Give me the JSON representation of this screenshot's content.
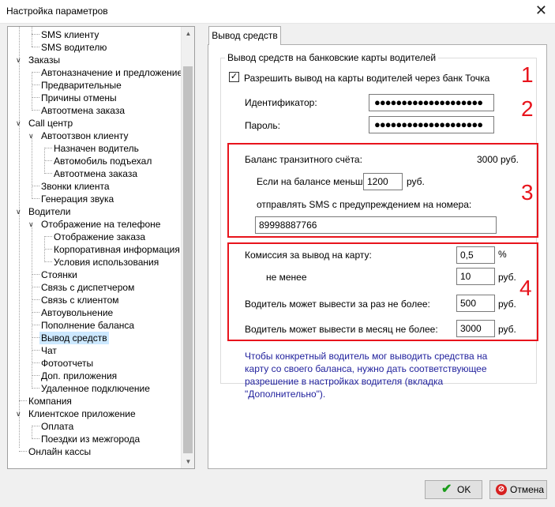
{
  "window": {
    "title": "Настройка параметров"
  },
  "tree": [
    "SMS клиенту",
    "SMS водителю",
    "Заказы",
    "Автоназначение и предложение",
    "Предварительные",
    "Причины отмены",
    "Автоотмена заказа",
    "Call центр",
    "Автоотзвон клиенту",
    "Назначен водитель",
    "Автомобиль подъехал",
    "Автоотмена заказа",
    "Звонки клиента",
    "Генерация звука",
    "Водители",
    "Отображение на телефоне",
    "Отображение заказа",
    "Корпоративная информация",
    "Условия использования",
    "Стоянки",
    "Связь с диспетчером",
    "Связь с клиентом",
    "Автоувольнение",
    "Пополнение баланса",
    "Вывод средств",
    "Чат",
    "Фотоотчеты",
    "Доп. приложения",
    "Удаленное подключение",
    "Компания",
    "Клиентское приложение",
    "Оплата",
    "Поездки из межгорода",
    "Онлайн кассы"
  ],
  "tab": {
    "label": "Вывод средств"
  },
  "group": {
    "title": "Вывод средств на банковские карты водителей"
  },
  "allow": {
    "label": "Разрешить вывод на карты водителей через банк Точка",
    "checked": true
  },
  "identifier": {
    "label": "Идентификатор:",
    "value": "●●●●●●●●●●●●●●●●●●●●"
  },
  "password": {
    "label": "Пароль:",
    "value": "●●●●●●●●●●●●●●●●●●●●"
  },
  "balance": {
    "label": "Баланс транзитного счёта:",
    "value": "3000 руб.",
    "if_less_label": "Если на балансе меньше",
    "threshold": "1200",
    "threshold_unit": "руб.",
    "sms_label": "отправлять SMS с предупреждением на номера:",
    "phones": "89998887766"
  },
  "commission": {
    "label": "Комиссия за вывод на карту:",
    "value": "0,5",
    "unit": "%",
    "min_label": "не менее",
    "min_value": "10",
    "min_unit": "руб."
  },
  "per_withdraw": {
    "label": "Водитель может вывести за раз не более:",
    "value": "500",
    "unit": "руб."
  },
  "per_month": {
    "label": "Водитель может вывести в месяц не более:",
    "value": "3000",
    "unit": "руб."
  },
  "note": "Чтобы конкретный водитель мог выводить средства на карту со своего баланса, нужно дать соответствующее разрешение в настройках водителя (вкладка \"Дополнительно\").",
  "annotations": [
    "1",
    "2",
    "3",
    "4"
  ],
  "buttons": {
    "ok": "OK",
    "cancel": "Отмена"
  },
  "colors": {
    "annotation": "#e8141c",
    "note": "#1f1f9c",
    "selection": "#cce8ff"
  }
}
